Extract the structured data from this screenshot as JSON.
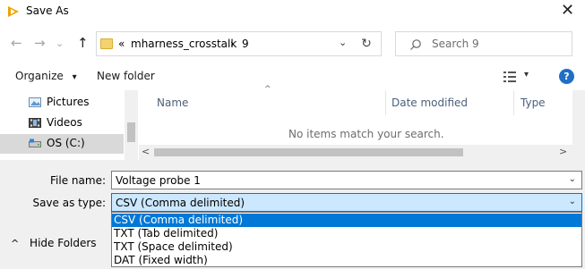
{
  "window": {
    "title": "Save As",
    "close_glyph": "✕",
    "icon": "app-icon"
  },
  "nav": {
    "back_glyph": "←",
    "forward_glyph": "→",
    "recent_glyph": "⌄",
    "up_glyph": "↑",
    "path_overflow": "«",
    "path": [
      "mharness_crosstalk",
      "9"
    ],
    "path_sep": "›",
    "dropdown_glyph": "⌄",
    "refresh_glyph": "↻",
    "search_placeholder": "Search 9"
  },
  "toolbar": {
    "organize": "Organize",
    "organize_caret": "▾",
    "new_folder": "New folder",
    "view_caret": "▾",
    "help": "?"
  },
  "sidebar": {
    "items": [
      {
        "label": "Pictures",
        "icon": "pictures-icon",
        "selected": false
      },
      {
        "label": "Videos",
        "icon": "videos-icon",
        "selected": false
      },
      {
        "label": "OS (C:)",
        "icon": "drive-icon",
        "selected": true
      }
    ]
  },
  "filelist": {
    "columns": [
      "Name",
      "Date modified",
      "Type"
    ],
    "sort_caret": "^",
    "empty_message": "No items match your search.",
    "scroll_left": "<",
    "scroll_right": ">"
  },
  "form": {
    "file_name_label": "File name:",
    "file_name_value": "Voltage probe 1",
    "save_type_label": "Save as type:",
    "save_type_value": "CSV (Comma delimited)",
    "dropdown_glyph": "⌄",
    "options": [
      "CSV (Comma delimited)",
      "TXT (Tab delimited)",
      "TXT (Space delimited)",
      "DAT (Fixed width)"
    ],
    "hide_folders_caret": "^",
    "hide_folders": "Hide Folders"
  },
  "colors": {
    "accent": "#0078d7",
    "selection_bg": "#cce8ff",
    "help": "#1f6fc5",
    "folder": "#f3d36d"
  }
}
